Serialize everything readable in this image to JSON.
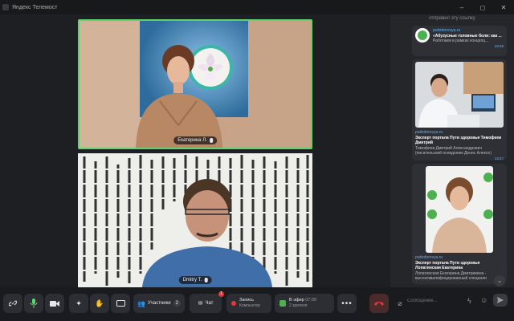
{
  "window": {
    "title": "Яндекс Телемост",
    "minimize": "–",
    "maximize": "◻",
    "close": "✕"
  },
  "tiles": [
    {
      "name": "Екатерина Л."
    },
    {
      "name": "Dmitry T."
    }
  ],
  "chat": {
    "top_text": "отправил эту ссылку",
    "messages": [
      {
        "site": "putizdorovya.ru",
        "title": "«Абузусные головные боли: как ...",
        "sub": "Работаем в рамках концепц...",
        "time": "13:46"
      },
      {
        "site": "putizdorovya.ru",
        "title": "Эксперт портала Пути здоровья Тимофеев Дмитрий",
        "sub1": "Тимофеев Дмитрий Александрович",
        "sub2": "(писательский псевдоним Денис Алексе)",
        "time": "13:47"
      },
      {
        "site": "putizdorovya.ru",
        "title": "Эксперт портала Пути здоровья Лопатинская Екатерина",
        "sub1": "Лопатинская Екатерина Дмитриевна -",
        "sub2": "высококвалифицированный специали",
        "time": ""
      }
    ],
    "input_placeholder": "Сообщение..."
  },
  "toolbar": {
    "participants_label": "Участники",
    "participants_count": "2",
    "chat_label": "Чат",
    "record_label": "Запись",
    "record_sub": "Компьютер",
    "live_label": "В эфир",
    "live_time": "07:09",
    "live_sub": "2 зрителя",
    "chat_badge": "1"
  },
  "colors": {
    "active_speaker": "#5fd36c",
    "hangup": "#e0383b",
    "link": "#58b6ff",
    "brand_green": "#4caf50"
  },
  "icons": [
    "link-icon",
    "mic-icon",
    "camera-icon",
    "effects-icon",
    "hand-icon",
    "screen-share-icon",
    "participants-icon",
    "chat-icon",
    "record-icon",
    "broadcast-icon",
    "more-icon",
    "hangup-icon",
    "attach-icon",
    "emoji-icon",
    "send-icon"
  ]
}
